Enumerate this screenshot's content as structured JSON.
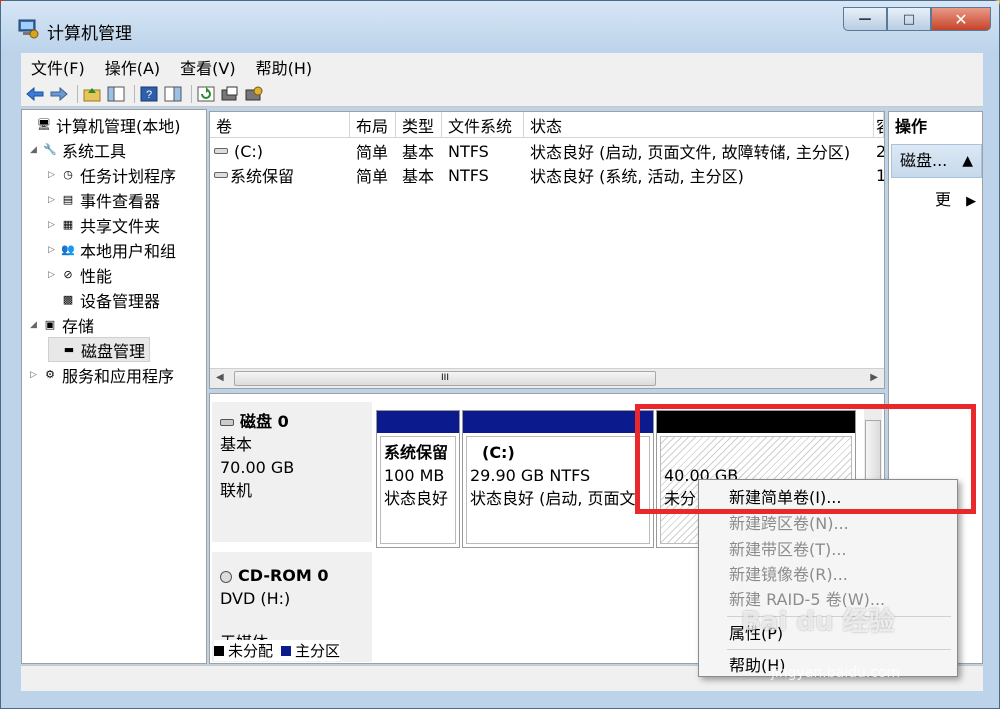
{
  "window": {
    "title": "计算机管理",
    "min_symbol": "—",
    "max_symbol": "□",
    "close_symbol": "✕"
  },
  "menu": [
    "文件(F)",
    "操作(A)",
    "查看(V)",
    "帮助(H)"
  ],
  "tree": [
    {
      "label": "计算机管理(本地)",
      "arrow": "",
      "icon": "computer-icon",
      "glyph": "🖥"
    },
    {
      "label": "系统工具",
      "arrow": "◢",
      "icon": "tools-icon",
      "glyph": "🔧"
    },
    {
      "label": "任务计划程序",
      "arrow": "▷",
      "icon": "clock-icon",
      "glyph": "◷"
    },
    {
      "label": "事件查看器",
      "arrow": "▷",
      "icon": "event-viewer-icon",
      "glyph": "▤"
    },
    {
      "label": "共享文件夹",
      "arrow": "▷",
      "icon": "shared-folder-icon",
      "glyph": "▦"
    },
    {
      "label": "本地用户和组",
      "arrow": "▷",
      "icon": "users-icon",
      "glyph": "👥"
    },
    {
      "label": "性能",
      "arrow": "▷",
      "icon": "performance-icon",
      "glyph": "⊘"
    },
    {
      "label": "设备管理器",
      "arrow": "",
      "icon": "device-manager-icon",
      "glyph": "▩"
    },
    {
      "label": "存储",
      "arrow": "◢",
      "icon": "storage-icon",
      "glyph": "▣"
    },
    {
      "label": "磁盘管理",
      "arrow": "",
      "icon": "disk-icon",
      "glyph": "▬"
    },
    {
      "label": "服务和应用程序",
      "arrow": "▷",
      "icon": "services-icon",
      "glyph": "⚙"
    }
  ],
  "volume_table": {
    "columns": [
      "卷",
      "布局",
      "类型",
      "文件系统",
      "状态",
      "容"
    ],
    "rows": [
      {
        "volume": "(C:)",
        "layout": "简单",
        "type": "基本",
        "fs": "NTFS",
        "status": "状态良好 (启动, 页面文件, 故障转储, 主分区)",
        "cap": "2"
      },
      {
        "volume": "系统保留",
        "layout": "简单",
        "type": "基本",
        "fs": "NTFS",
        "status": "状态良好 (系统, 活动, 主分区)",
        "cap": "1"
      }
    ],
    "scroll_left": "◀",
    "scroll_right": "▶",
    "scroll_grip": "III"
  },
  "actions": {
    "header": "操作",
    "group": "磁盘...",
    "group_arrow": "▲",
    "more": "更",
    "more_arrow": "▶"
  },
  "disks": {
    "disk0": {
      "name": "磁盘 0",
      "type": "基本",
      "size": "70.00 GB",
      "state": "联机",
      "partitions": [
        {
          "name": "系统保留",
          "size": "100 MB",
          "status": "状态良好"
        },
        {
          "name": "(C:)",
          "size": "29.90 GB NTFS",
          "status": "状态良好 (启动, 页面文"
        },
        {
          "name": "",
          "size": "40.00 GB",
          "status": "未分"
        }
      ]
    },
    "cdrom": {
      "name": "CD-ROM 0",
      "drive": "DVD (H:)",
      "extra": "无媒体"
    }
  },
  "legend": [
    {
      "label": "未分配",
      "color": "#000000"
    },
    {
      "label": "主分区",
      "color": "#0b1a8c"
    }
  ],
  "context_menu": {
    "items": [
      {
        "label": "新建简单卷(I)...",
        "enabled": true
      },
      {
        "label": "新建跨区卷(N)...",
        "enabled": false
      },
      {
        "label": "新建带区卷(T)...",
        "enabled": false
      },
      {
        "label": "新建镜像卷(R)...",
        "enabled": false
      },
      {
        "label": "新建 RAID-5 卷(W)...",
        "enabled": false
      },
      {
        "label": "属性(P)",
        "enabled": true
      },
      {
        "label": "帮助(H)",
        "enabled": true
      }
    ]
  },
  "watermark": {
    "brand": "Bai du 经验",
    "url": "jingyan.baidu.com"
  },
  "colors": {
    "primary_partition": "#0b1a8c",
    "unallocated": "#000000",
    "highlight": "#e8282a"
  }
}
